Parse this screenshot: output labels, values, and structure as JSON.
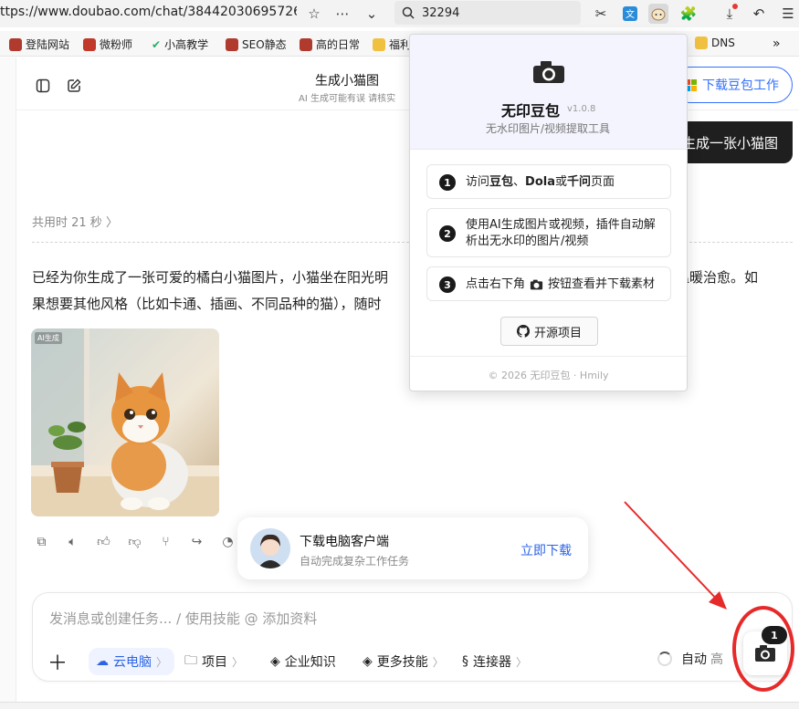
{
  "browser": {
    "url": "ttps://www.doubao.com/chat/384420306957265",
    "search_value": "32294",
    "bookmarks": [
      {
        "label": "登陆网站",
        "color": "#c0392b"
      },
      {
        "label": "微粉师",
        "color": "#c0392b"
      },
      {
        "label": "小高教学",
        "color": "#27ae60"
      },
      {
        "label": "SEO静态",
        "color": "#c0392b"
      },
      {
        "label": "高的日常",
        "color": "#c0392b"
      },
      {
        "label": "福利",
        "color": "#f0c040"
      },
      {
        "label": "DNS",
        "color": "#f0c040"
      }
    ],
    "more_bookmarks": "»"
  },
  "header": {
    "title": "生成小猫图",
    "subtitle": "AI 生成可能有误 请核实",
    "download_button": "下载豆包工作"
  },
  "user_message": "生成一张小猫图",
  "assistant": {
    "elapsed": "共用时 21 秒",
    "answer_line1": "已经为你生成了一张可爱的橘白小猫图片，小猫坐在阳光明",
    "answer_line1_tail": "围温暖治愈。如",
    "answer_line2": "果想要其他风格（比如卡通、插画、不同品种的猫），随时",
    "image_badge": "AI生成"
  },
  "promo": {
    "title": "下载电脑客户端",
    "subtitle": "自动完成复杂工作任务",
    "link": "立即下载"
  },
  "composer": {
    "placeholder": "发消息或创建任务... / 使用技能 @ 添加资料",
    "tools": [
      {
        "label": "云电脑"
      },
      {
        "label": "项目"
      },
      {
        "label": "企业知识"
      },
      {
        "label": "更多技能"
      },
      {
        "label": "连接器"
      }
    ],
    "mode": "自动",
    "mode_tail": "高"
  },
  "camera_badge": "1",
  "popup": {
    "name": "无印豆包",
    "version": "v1.0.8",
    "description": "无水印图片/视频提取工具",
    "step1_pre": "访问",
    "step1_b1": "豆包",
    "step1_sep1": "、",
    "step1_b2": "Dola",
    "step1_sep2": "或",
    "step1_b3": "千问",
    "step1_post": "页面",
    "step2_line1": "使用AI生成图片或视频，插件自动解",
    "step2_line2": "析出无水印的图片/视频",
    "step3_pre": "点击右下角",
    "step3_post": "按钮查看并下载素材",
    "github_button": "开源项目",
    "footer": "© 2026 无印豆包 · Hmily"
  }
}
